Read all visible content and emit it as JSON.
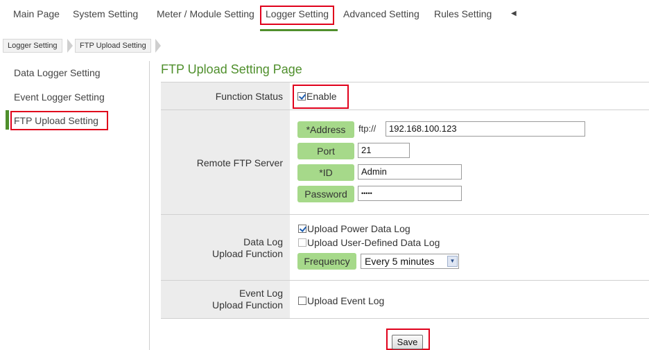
{
  "nav": {
    "items": [
      "Main Page",
      "System Setting",
      "Meter / Module Setting",
      "Logger Setting",
      "Advanced Setting",
      "Rules Setting"
    ],
    "active": "Logger Setting",
    "more_icon": "caret-left-icon"
  },
  "breadcrumb": [
    "Logger Setting",
    "FTP Upload Setting"
  ],
  "sidebar": {
    "items": [
      {
        "label": "Data Logger Setting"
      },
      {
        "label": "Event Logger Setting"
      },
      {
        "label": "FTP Upload Setting"
      }
    ],
    "active": "FTP Upload Setting"
  },
  "page": {
    "title": "FTP Upload Setting Page"
  },
  "form": {
    "function_status": {
      "label": "Function Status",
      "checkbox_label": "Enable",
      "checked": true
    },
    "remote_ftp": {
      "label": "Remote FTP Server",
      "address_label": "*Address",
      "address_prefix": "ftp://",
      "address_value": "192.168.100.123",
      "port_label": "Port",
      "port_value": "21",
      "id_label": "*ID",
      "id_value": "Admin",
      "password_label": "Password",
      "password_value": "•••••"
    },
    "data_log": {
      "label_line1": "Data Log",
      "label_line2": "Upload Function",
      "upload_power": {
        "label": "Upload Power Data Log",
        "checked": true
      },
      "upload_user": {
        "label": "Upload User-Defined Data Log",
        "checked": false
      },
      "frequency_label": "Frequency",
      "frequency_value": "Every 5 minutes"
    },
    "event_log": {
      "label_line1": "Event Log",
      "label_line2": "Upload Function",
      "upload_event": {
        "label": "Upload Event Log",
        "checked": false
      }
    }
  },
  "actions": {
    "save_label": "Save"
  },
  "colors": {
    "accent_green": "#4f8f2c",
    "pill_green": "#a6d98a",
    "highlight_red": "#e0001b"
  }
}
